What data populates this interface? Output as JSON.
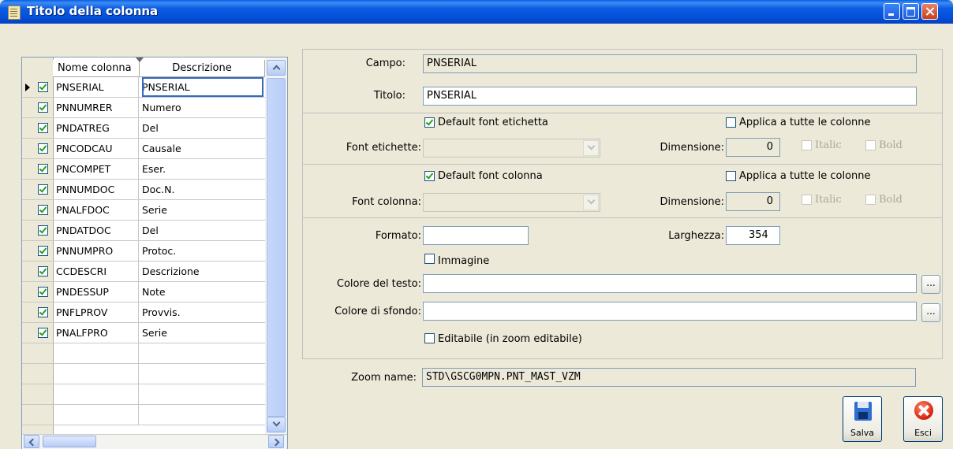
{
  "window": {
    "title": "Titolo della colonna"
  },
  "grid": {
    "headers": {
      "name": "Nome colonna",
      "description": "Descrizione"
    },
    "rows": [
      {
        "name": "PNSERIAL",
        "description": "PNSERIAL",
        "checked": true
      },
      {
        "name": "PNNUMRER",
        "description": "Numero",
        "checked": true
      },
      {
        "name": "PNDATREG",
        "description": "Del",
        "checked": true
      },
      {
        "name": "PNCODCAU",
        "description": "Causale",
        "checked": true
      },
      {
        "name": "PNCOMPET",
        "description": "Eser.",
        "checked": true
      },
      {
        "name": "PNNUMDOC",
        "description": "Doc.N.",
        "checked": true
      },
      {
        "name": "PNALFDOC",
        "description": "Serie",
        "checked": true
      },
      {
        "name": "PNDATDOC",
        "description": "Del",
        "checked": true
      },
      {
        "name": "PNNUMPRO",
        "description": "Protoc.",
        "checked": true
      },
      {
        "name": "CCDESCRI",
        "description": "Descrizione",
        "checked": true
      },
      {
        "name": "PNDESSUP",
        "description": "Note",
        "checked": true
      },
      {
        "name": "PNFLPROV",
        "description": "Provvis.",
        "checked": true
      },
      {
        "name": "PNALFPRO",
        "description": "Serie",
        "checked": true
      }
    ],
    "selected_row": 0
  },
  "form": {
    "campo_label": "Campo:",
    "campo_value": "PNSERIAL",
    "titolo_label": "Titolo:",
    "titolo_value": "PNSERIAL",
    "label_font": {
      "default_label": "Default font etichetta",
      "default_checked": true,
      "apply_all_label": "Applica a tutte le colonne",
      "apply_all_checked": false,
      "font_label": "Font etichette:",
      "font_value": "",
      "size_label": "Dimensione:",
      "size_value": "0",
      "italic_label": "Italic",
      "bold_label": "Bold"
    },
    "column_font": {
      "default_label": "Default font colonna",
      "default_checked": true,
      "apply_all_label": "Applica a tutte le colonne",
      "apply_all_checked": false,
      "font_label": "Font colonna:",
      "font_value": "",
      "size_label": "Dimensione:",
      "size_value": "0",
      "italic_label": "Italic",
      "bold_label": "Bold"
    },
    "formato_label": "Formato:",
    "formato_value": "",
    "larghezza_label": "Larghezza:",
    "larghezza_value": "354",
    "immagine_label": "Immagine",
    "immagine_checked": false,
    "text_color_label": "Colore del testo:",
    "text_color_value": "",
    "bg_color_label": "Colore di sfondo:",
    "bg_color_value": "",
    "dots_label": "...",
    "editable_label": "Editabile (in zoom editabile)",
    "editable_checked": false,
    "zoom_label": "Zoom name:",
    "zoom_value": "STD\\GSCG0MPN.PNT_MAST_VZM"
  },
  "buttons": {
    "save": "Salva",
    "exit": "Esci"
  },
  "colors": {
    "titlebar": "#0550d8",
    "face": "#ece9d8",
    "field_border": "#7f9db9",
    "check": "#21a121"
  }
}
